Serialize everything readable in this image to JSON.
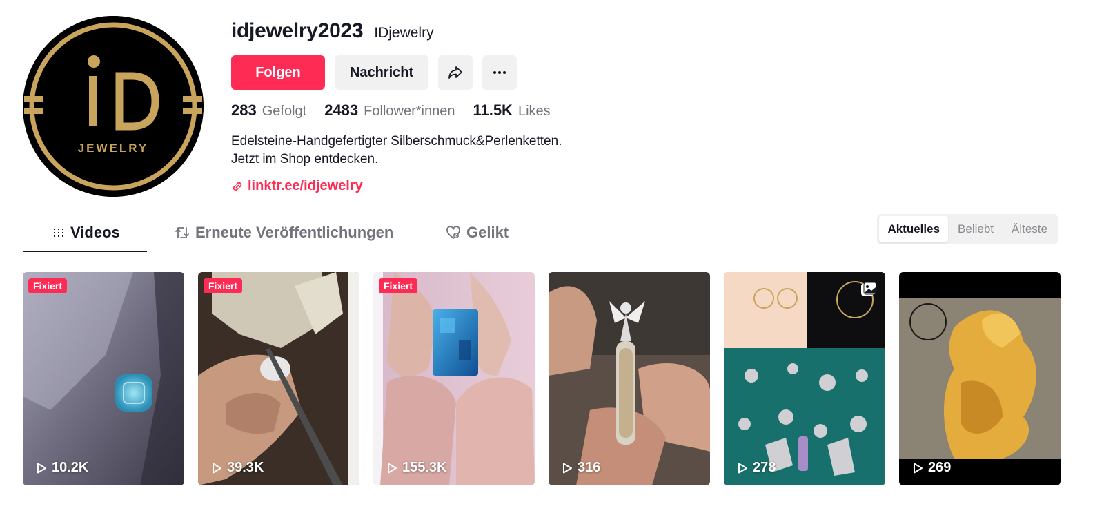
{
  "profile": {
    "username": "idjewelry2023",
    "nickname": "IDjewelry",
    "avatar_text_main": "iD",
    "avatar_text_sub": "JEWELRY",
    "follow_label": "Folgen",
    "message_label": "Nachricht",
    "share_icon": "share-icon",
    "more_icon": "more-icon",
    "stats": [
      {
        "number": "283",
        "label": "Gefolgt"
      },
      {
        "number": "2483",
        "label": "Follower*innen"
      },
      {
        "number": "11.5K",
        "label": "Likes"
      }
    ],
    "bio": "Edelsteine-Handgefertigter Silberschmuck&Perlenketten.\nJetzt im Shop entdecken.",
    "link": "linktr.ee/idjewelry"
  },
  "tabs": [
    {
      "label": "Videos",
      "icon": "grid-icon",
      "active": true
    },
    {
      "label": "Erneute Veröffentlichungen",
      "icon": "repost-icon",
      "active": false
    },
    {
      "label": "Gelikt",
      "icon": "liked-icon",
      "active": false
    }
  ],
  "sort": [
    {
      "label": "Aktuelles",
      "active": true
    },
    {
      "label": "Beliebt",
      "active": false
    },
    {
      "label": "Älteste",
      "active": false
    }
  ],
  "videos": [
    {
      "pinned_label": "Fixiert",
      "views": "10.2K"
    },
    {
      "pinned_label": "Fixiert",
      "views": "39.3K"
    },
    {
      "pinned_label": "Fixiert",
      "views": "155.3K"
    },
    {
      "pinned_label": "",
      "views": "316"
    },
    {
      "pinned_label": "",
      "views": "278"
    },
    {
      "pinned_label": "",
      "views": "269"
    }
  ],
  "colors": {
    "accent": "#fe2c55",
    "text": "#161823",
    "muted": "#73747b",
    "button_bg": "#f1f1f2",
    "logo_gold": "#c9a45c"
  }
}
